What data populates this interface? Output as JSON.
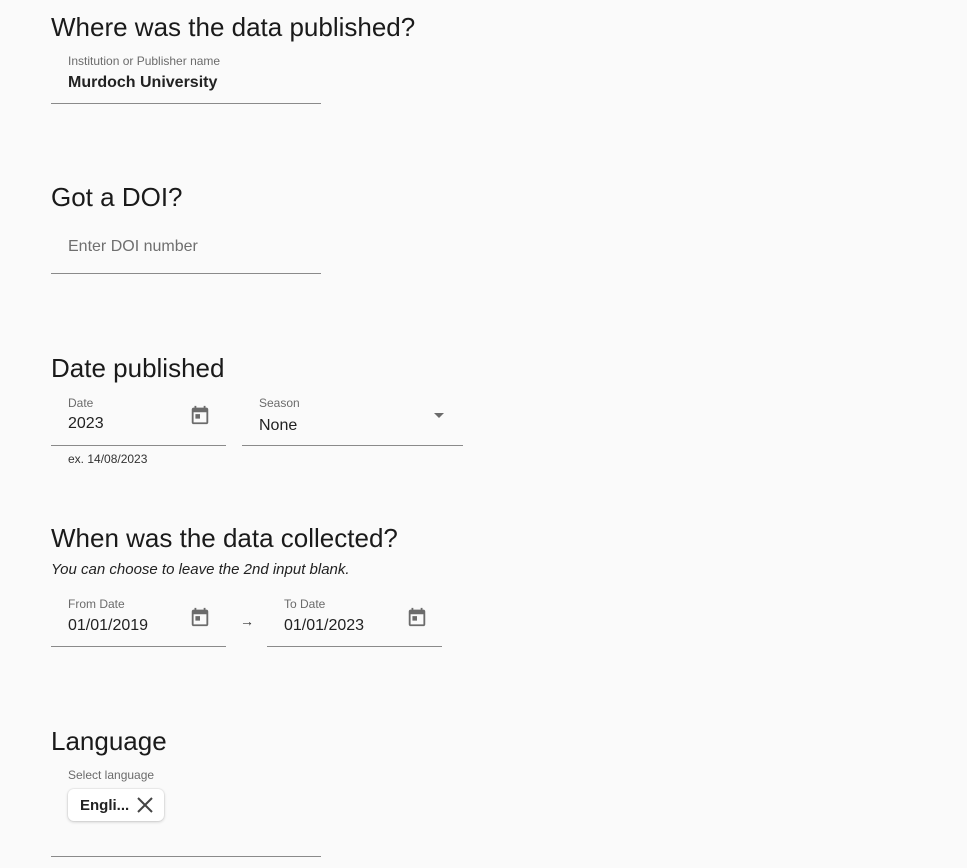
{
  "publisher": {
    "heading": "Where was the data published?",
    "label": "Institution or Publisher name",
    "value": "Murdoch University"
  },
  "doi": {
    "heading": "Got a DOI?",
    "placeholder": "Enter DOI number"
  },
  "date_published": {
    "heading": "Date published",
    "date_label": "Date",
    "date_value": "2023",
    "date_hint": "ex. 14/08/2023",
    "season_label": "Season",
    "season_value": "None"
  },
  "collection": {
    "heading": "When was the data collected?",
    "subtitle": "You can choose to leave the 2nd input blank.",
    "from_label": "From Date",
    "from_value": "01/01/2019",
    "to_label": "To Date",
    "to_value": "01/01/2023",
    "arrow": "→"
  },
  "language": {
    "heading": "Language",
    "label": "Select language",
    "chip": "Engli..."
  },
  "icons": {
    "calendar": "calendar-icon",
    "dropdown": "caret-down-icon",
    "close": "close-icon",
    "arrow": "arrow-right-icon"
  },
  "colors": {
    "background": "#fafafa",
    "underline": "#8a8a8a",
    "icon": "#6b6b6b"
  }
}
